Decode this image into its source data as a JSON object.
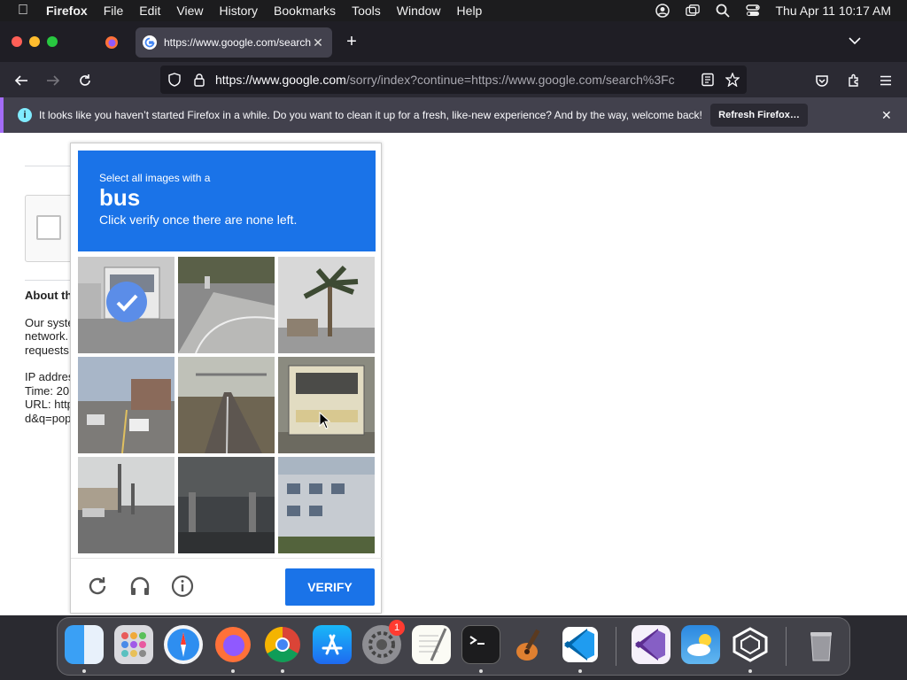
{
  "menubar": {
    "app_name": "Firefox",
    "items": [
      "File",
      "Edit",
      "View",
      "History",
      "Bookmarks",
      "Tools",
      "Window",
      "Help"
    ],
    "clock": "Thu Apr 11  10:17 AM"
  },
  "browser": {
    "tab_title": "https://www.google.com/search?",
    "url_host": "https://www.google.com",
    "url_path": "/sorry/index?continue=https://www.google.com/search%3Fc",
    "notification": {
      "message": "It looks like you haven’t started Firefox in a while. Do you want to clean it up for a fresh, like-new experience? And by the way, welcome back!",
      "button": "Refresh Firefox…"
    }
  },
  "page": {
    "about_heading": "About th",
    "body_lines": [
      "Our syste",
      "network.",
      "requests"
    ],
    "info_lines": [
      "IP addres",
      "Time: 20",
      "URL: http",
      "d&q=pop"
    ]
  },
  "captcha": {
    "prompt": "Select all images with a",
    "keyword": "bus",
    "subtext": "Click verify once there are none left.",
    "verify_label": "VERIFY",
    "tiles": [
      {
        "name": "bus-street",
        "selected": true
      },
      {
        "name": "road-cyclist",
        "selected": false
      },
      {
        "name": "palm-tree",
        "selected": false
      },
      {
        "name": "street-cars",
        "selected": false
      },
      {
        "name": "highway-road",
        "selected": false
      },
      {
        "name": "school-bus",
        "selected": false
      },
      {
        "name": "intersection",
        "selected": false
      },
      {
        "name": "overpass",
        "selected": false
      },
      {
        "name": "building",
        "selected": false
      }
    ]
  },
  "dock": {
    "apps": [
      "Finder",
      "Launchpad",
      "Safari",
      "Firefox",
      "Chrome",
      "App Store",
      "System Settings",
      "TextEdit",
      "Terminal",
      "GarageBand",
      "VS Code",
      "Visual Studio",
      "Weather",
      "Unity",
      "Trash"
    ],
    "settings_badge": "1"
  },
  "colors": {
    "captcha_blue": "#1a73e8",
    "menubar_bg": "#1c1c1e",
    "tab_bg": "#42414d"
  }
}
